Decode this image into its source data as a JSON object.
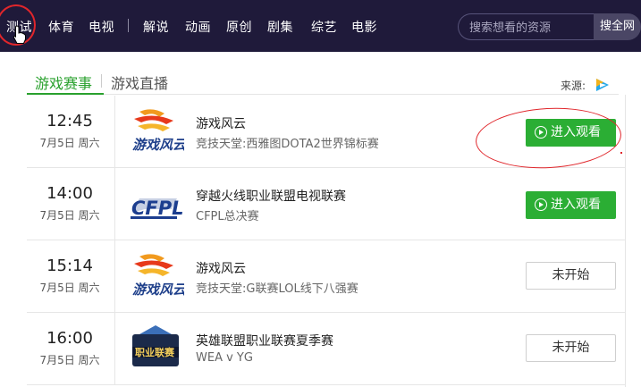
{
  "nav": {
    "items": [
      "测试",
      "体育",
      "电视",
      "解说",
      "动画",
      "原创",
      "剧集",
      "综艺",
      "电影"
    ],
    "search_placeholder": "搜索想看的资源",
    "search_button": "搜全网"
  },
  "tabs": {
    "active": "游戏赛事",
    "other": "游戏直播"
  },
  "source_label": "来源:",
  "rows": [
    {
      "time": "12:45",
      "date": "7月5日 周六",
      "title": "游戏风云",
      "subtitle": "竞技天堂:西雅图DOTA2世界锦标赛",
      "button": "进入观看",
      "logo": "youxifengyun-logo"
    },
    {
      "time": "14:00",
      "date": "7月5日 周六",
      "title": "穿越火线职业联盟电视联赛",
      "subtitle": "CFPL总决赛",
      "button": "进入观看",
      "logo": "cfpl-logo"
    },
    {
      "time": "15:14",
      "date": "7月5日 周六",
      "title": "游戏风云",
      "subtitle": "竞技天堂:G联赛LOL线下八强赛",
      "button": "未开始",
      "logo": "youxifengyun-logo"
    },
    {
      "time": "16:00",
      "date": "7月5日 周六",
      "title": "英雄联盟职业联赛夏季赛",
      "subtitle": "WEA v YG",
      "button": "未开始",
      "logo": "lpl-logo"
    }
  ],
  "logo_text": {
    "fengyun": "游戏风云",
    "cfpl": "CFPL",
    "lpl": "职业联赛"
  },
  "colors": {
    "nav_bg": "#1f1a3a",
    "accent_green": "#2bae34",
    "annotation_red": "#e0262b"
  }
}
